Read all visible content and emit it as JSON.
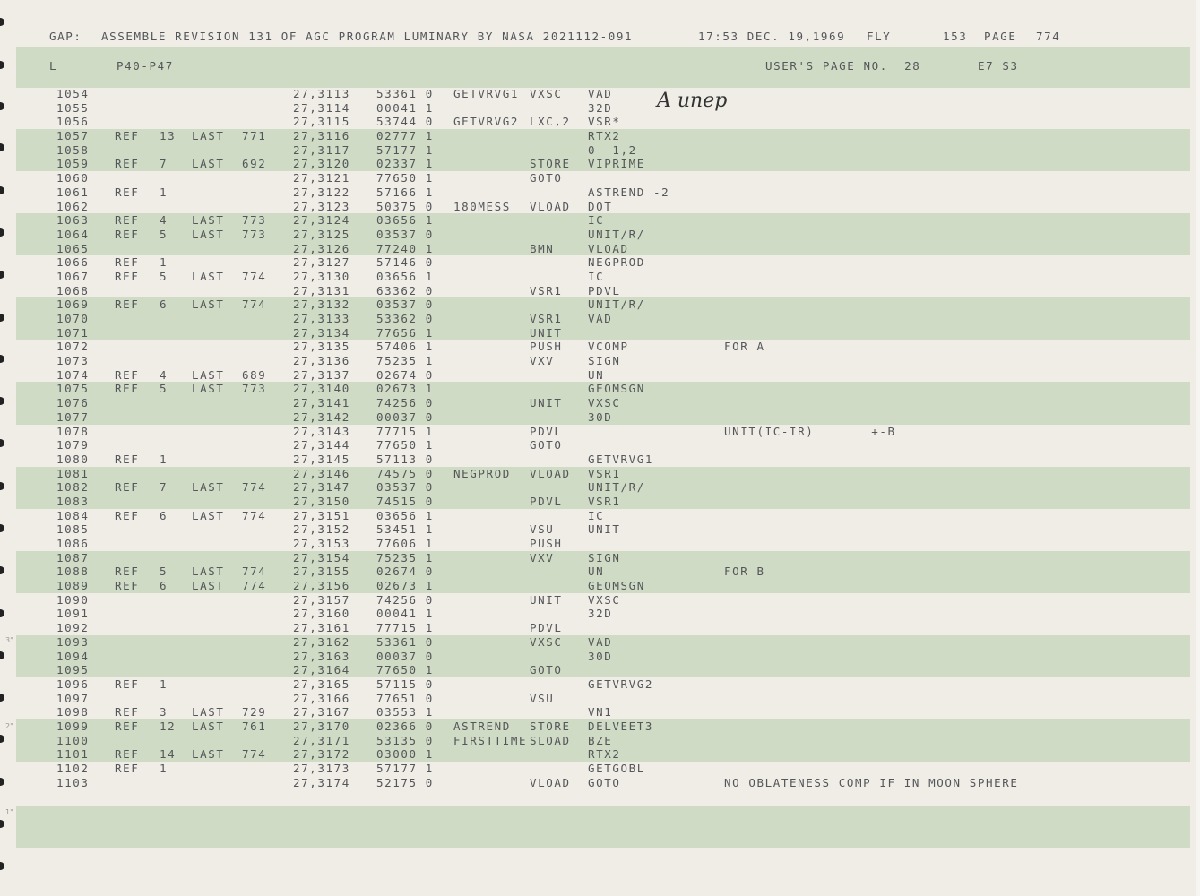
{
  "header": {
    "gap": "GAP:",
    "assemble": "ASSEMBLE REVISION 131 OF AGC PROGRAM LUMINARY BY NASA 2021112-091",
    "time": "17:53 DEC. 19,1969",
    "mode": "FLY",
    "num": "153",
    "page_label": "PAGE",
    "page_num": "774"
  },
  "subheader": {
    "l": "L",
    "program": "P40-P47",
    "users_page": "USER'S PAGE NO.  28",
    "code": "E7 S3"
  },
  "annotation": "A unep",
  "rows": [
    {
      "line": "1054",
      "ref": "",
      "refn": "",
      "last": "",
      "lastn": "",
      "addr": "27,3113",
      "word": "53361 0",
      "label": "GETVRVG1",
      "op": "VXSC",
      "operand": "VAD",
      "comment": ""
    },
    {
      "line": "1055",
      "ref": "",
      "refn": "",
      "last": "",
      "lastn": "",
      "addr": "27,3114",
      "word": "00041 1",
      "label": "",
      "op": "",
      "operand": "32D",
      "comment": ""
    },
    {
      "line": "1056",
      "ref": "",
      "refn": "",
      "last": "",
      "lastn": "",
      "addr": "27,3115",
      "word": "53744 0",
      "label": "GETVRVG2",
      "op": "LXC,2",
      "operand": "VSR*",
      "comment": ""
    },
    {
      "line": "1057",
      "ref": "REF",
      "refn": "13",
      "last": "LAST",
      "lastn": "771",
      "addr": "27,3116",
      "word": "02777 1",
      "label": "",
      "op": "",
      "operand": "RTX2",
      "comment": ""
    },
    {
      "line": "1058",
      "ref": "",
      "refn": "",
      "last": "",
      "lastn": "",
      "addr": "27,3117",
      "word": "57177 1",
      "label": "",
      "op": "",
      "operand": "0 -1,2",
      "comment": ""
    },
    {
      "line": "1059",
      "ref": "REF",
      "refn": "7",
      "last": "LAST",
      "lastn": "692",
      "addr": "27,3120",
      "word": "02337 1",
      "label": "",
      "op": "STORE",
      "operand": "VIPRIME",
      "comment": ""
    },
    {
      "line": "1060",
      "ref": "",
      "refn": "",
      "last": "",
      "lastn": "",
      "addr": "27,3121",
      "word": "77650 1",
      "label": "",
      "op": "GOTO",
      "operand": "",
      "comment": ""
    },
    {
      "line": "1061",
      "ref": "REF",
      "refn": "1",
      "last": "",
      "lastn": "",
      "addr": "27,3122",
      "word": "57166 1",
      "label": "",
      "op": "",
      "operand": "ASTREND -2",
      "comment": ""
    },
    {
      "line": "1062",
      "ref": "",
      "refn": "",
      "last": "",
      "lastn": "",
      "addr": "27,3123",
      "word": "50375 0",
      "label": "180MESS",
      "op": "VLOAD",
      "operand": "DOT",
      "comment": ""
    },
    {
      "line": "1063",
      "ref": "REF",
      "refn": "4",
      "last": "LAST",
      "lastn": "773",
      "addr": "27,3124",
      "word": "03656 1",
      "label": "",
      "op": "",
      "operand": "IC",
      "comment": ""
    },
    {
      "line": "1064",
      "ref": "REF",
      "refn": "5",
      "last": "LAST",
      "lastn": "773",
      "addr": "27,3125",
      "word": "03537 0",
      "label": "",
      "op": "",
      "operand": "UNIT/R/",
      "comment": ""
    },
    {
      "line": "1065",
      "ref": "",
      "refn": "",
      "last": "",
      "lastn": "",
      "addr": "27,3126",
      "word": "77240 1",
      "label": "",
      "op": "BMN",
      "operand": "VLOAD",
      "comment": ""
    },
    {
      "line": "1066",
      "ref": "REF",
      "refn": "1",
      "last": "",
      "lastn": "",
      "addr": "27,3127",
      "word": "57146 0",
      "label": "",
      "op": "",
      "operand": "NEGPROD",
      "comment": ""
    },
    {
      "line": "1067",
      "ref": "REF",
      "refn": "5",
      "last": "LAST",
      "lastn": "774",
      "addr": "27,3130",
      "word": "03656 1",
      "label": "",
      "op": "",
      "operand": "IC",
      "comment": ""
    },
    {
      "line": "1068",
      "ref": "",
      "refn": "",
      "last": "",
      "lastn": "",
      "addr": "27,3131",
      "word": "63362 0",
      "label": "",
      "op": "VSR1",
      "operand": "PDVL",
      "comment": ""
    },
    {
      "line": "1069",
      "ref": "REF",
      "refn": "6",
      "last": "LAST",
      "lastn": "774",
      "addr": "27,3132",
      "word": "03537 0",
      "label": "",
      "op": "",
      "operand": "UNIT/R/",
      "comment": ""
    },
    {
      "line": "1070",
      "ref": "",
      "refn": "",
      "last": "",
      "lastn": "",
      "addr": "27,3133",
      "word": "53362 0",
      "label": "",
      "op": "VSR1",
      "operand": "VAD",
      "comment": ""
    },
    {
      "line": "1071",
      "ref": "",
      "refn": "",
      "last": "",
      "lastn": "",
      "addr": "27,3134",
      "word": "77656 1",
      "label": "",
      "op": "UNIT",
      "operand": "",
      "comment": ""
    },
    {
      "line": "1072",
      "ref": "",
      "refn": "",
      "last": "",
      "lastn": "",
      "addr": "27,3135",
      "word": "57406 1",
      "label": "",
      "op": "PUSH",
      "operand": "VCOMP",
      "comment": "FOR A"
    },
    {
      "line": "1073",
      "ref": "",
      "refn": "",
      "last": "",
      "lastn": "",
      "addr": "27,3136",
      "word": "75235 1",
      "label": "",
      "op": "VXV",
      "operand": "SIGN",
      "comment": ""
    },
    {
      "line": "1074",
      "ref": "REF",
      "refn": "4",
      "last": "LAST",
      "lastn": "689",
      "addr": "27,3137",
      "word": "02674 0",
      "label": "",
      "op": "",
      "operand": "UN",
      "comment": ""
    },
    {
      "line": "1075",
      "ref": "REF",
      "refn": "5",
      "last": "LAST",
      "lastn": "773",
      "addr": "27,3140",
      "word": "02673 1",
      "label": "",
      "op": "",
      "operand": "GEOMSGN",
      "comment": ""
    },
    {
      "line": "1076",
      "ref": "",
      "refn": "",
      "last": "",
      "lastn": "",
      "addr": "27,3141",
      "word": "74256 0",
      "label": "",
      "op": "UNIT",
      "operand": "VXSC",
      "comment": ""
    },
    {
      "line": "1077",
      "ref": "",
      "refn": "",
      "last": "",
      "lastn": "",
      "addr": "27,3142",
      "word": "00037 0",
      "label": "",
      "op": "",
      "operand": "30D",
      "comment": ""
    },
    {
      "line": "1078",
      "ref": "",
      "refn": "",
      "last": "",
      "lastn": "",
      "addr": "27,3143",
      "word": "77715 1",
      "label": "",
      "op": "PDVL",
      "operand": "",
      "comment": "UNIT(IC-IR)       +-B"
    },
    {
      "line": "1079",
      "ref": "",
      "refn": "",
      "last": "",
      "lastn": "",
      "addr": "27,3144",
      "word": "77650 1",
      "label": "",
      "op": "GOTO",
      "operand": "",
      "comment": ""
    },
    {
      "line": "1080",
      "ref": "REF",
      "refn": "1",
      "last": "",
      "lastn": "",
      "addr": "27,3145",
      "word": "57113 0",
      "label": "",
      "op": "",
      "operand": "GETVRVG1",
      "comment": ""
    },
    {
      "line": "1081",
      "ref": "",
      "refn": "",
      "last": "",
      "lastn": "",
      "addr": "27,3146",
      "word": "74575 0",
      "label": "NEGPROD",
      "op": "VLOAD",
      "operand": "VSR1",
      "comment": ""
    },
    {
      "line": "1082",
      "ref": "REF",
      "refn": "7",
      "last": "LAST",
      "lastn": "774",
      "addr": "27,3147",
      "word": "03537 0",
      "label": "",
      "op": "",
      "operand": "UNIT/R/",
      "comment": ""
    },
    {
      "line": "1083",
      "ref": "",
      "refn": "",
      "last": "",
      "lastn": "",
      "addr": "27,3150",
      "word": "74515 0",
      "label": "",
      "op": "PDVL",
      "operand": "VSR1",
      "comment": ""
    },
    {
      "line": "1084",
      "ref": "REF",
      "refn": "6",
      "last": "LAST",
      "lastn": "774",
      "addr": "27,3151",
      "word": "03656 1",
      "label": "",
      "op": "",
      "operand": "IC",
      "comment": ""
    },
    {
      "line": "1085",
      "ref": "",
      "refn": "",
      "last": "",
      "lastn": "",
      "addr": "27,3152",
      "word": "53451 1",
      "label": "",
      "op": "VSU",
      "operand": "UNIT",
      "comment": ""
    },
    {
      "line": "1086",
      "ref": "",
      "refn": "",
      "last": "",
      "lastn": "",
      "addr": "27,3153",
      "word": "77606 1",
      "label": "",
      "op": "PUSH",
      "operand": "",
      "comment": ""
    },
    {
      "line": "1087",
      "ref": "",
      "refn": "",
      "last": "",
      "lastn": "",
      "addr": "27,3154",
      "word": "75235 1",
      "label": "",
      "op": "VXV",
      "operand": "SIGN",
      "comment": ""
    },
    {
      "line": "1088",
      "ref": "REF",
      "refn": "5",
      "last": "LAST",
      "lastn": "774",
      "addr": "27,3155",
      "word": "02674 0",
      "label": "",
      "op": "",
      "operand": "UN",
      "comment": "FOR B"
    },
    {
      "line": "1089",
      "ref": "REF",
      "refn": "6",
      "last": "LAST",
      "lastn": "774",
      "addr": "27,3156",
      "word": "02673 1",
      "label": "",
      "op": "",
      "operand": "GEOMSGN",
      "comment": ""
    },
    {
      "line": "1090",
      "ref": "",
      "refn": "",
      "last": "",
      "lastn": "",
      "addr": "27,3157",
      "word": "74256 0",
      "label": "",
      "op": "UNIT",
      "operand": "VXSC",
      "comment": ""
    },
    {
      "line": "1091",
      "ref": "",
      "refn": "",
      "last": "",
      "lastn": "",
      "addr": "27,3160",
      "word": "00041 1",
      "label": "",
      "op": "",
      "operand": "32D",
      "comment": ""
    },
    {
      "line": "1092",
      "ref": "",
      "refn": "",
      "last": "",
      "lastn": "",
      "addr": "27,3161",
      "word": "77715 1",
      "label": "",
      "op": "PDVL",
      "operand": "",
      "comment": ""
    },
    {
      "line": "1093",
      "ref": "",
      "refn": "",
      "last": "",
      "lastn": "",
      "addr": "27,3162",
      "word": "53361 0",
      "label": "",
      "op": "VXSC",
      "operand": "VAD",
      "comment": ""
    },
    {
      "line": "1094",
      "ref": "",
      "refn": "",
      "last": "",
      "lastn": "",
      "addr": "27,3163",
      "word": "00037 0",
      "label": "",
      "op": "",
      "operand": "30D",
      "comment": ""
    },
    {
      "line": "1095",
      "ref": "",
      "refn": "",
      "last": "",
      "lastn": "",
      "addr": "27,3164",
      "word": "77650 1",
      "label": "",
      "op": "GOTO",
      "operand": "",
      "comment": ""
    },
    {
      "line": "1096",
      "ref": "REF",
      "refn": "1",
      "last": "",
      "lastn": "",
      "addr": "27,3165",
      "word": "57115 0",
      "label": "",
      "op": "",
      "operand": "GETVRVG2",
      "comment": ""
    },
    {
      "line": "1097",
      "ref": "",
      "refn": "",
      "last": "",
      "lastn": "",
      "addr": "27,3166",
      "word": "77651 0",
      "label": "",
      "op": "VSU",
      "operand": "",
      "comment": ""
    },
    {
      "line": "1098",
      "ref": "REF",
      "refn": "3",
      "last": "LAST",
      "lastn": "729",
      "addr": "27,3167",
      "word": "03553 1",
      "label": "",
      "op": "",
      "operand": "VN1",
      "comment": ""
    },
    {
      "line": "1099",
      "ref": "REF",
      "refn": "12",
      "last": "LAST",
      "lastn": "761",
      "addr": "27,3170",
      "word": "02366 0",
      "label": "ASTREND",
      "op": "STORE",
      "operand": "DELVEET3",
      "comment": ""
    },
    {
      "line": "1100",
      "ref": "",
      "refn": "",
      "last": "",
      "lastn": "",
      "addr": "27,3171",
      "word": "53135 0",
      "label": "FIRSTTIME",
      "op": "SLOAD",
      "operand": "BZE",
      "comment": ""
    },
    {
      "line": "1101",
      "ref": "REF",
      "refn": "14",
      "last": "LAST",
      "lastn": "774",
      "addr": "27,3172",
      "word": "03000 1",
      "label": "",
      "op": "",
      "operand": "RTX2",
      "comment": ""
    },
    {
      "line": "1102",
      "ref": "REF",
      "refn": "1",
      "last": "",
      "lastn": "",
      "addr": "27,3173",
      "word": "57177 1",
      "label": "",
      "op": "",
      "operand": "GETGOBL",
      "comment": ""
    },
    {
      "line": "1103",
      "ref": "",
      "refn": "",
      "last": "",
      "lastn": "",
      "addr": "27,3174",
      "word": "52175 0",
      "label": "",
      "op": "VLOAD",
      "operand": "GOTO",
      "comment": "NO OBLATENESS COMP IF IN MOON SPHERE"
    }
  ]
}
